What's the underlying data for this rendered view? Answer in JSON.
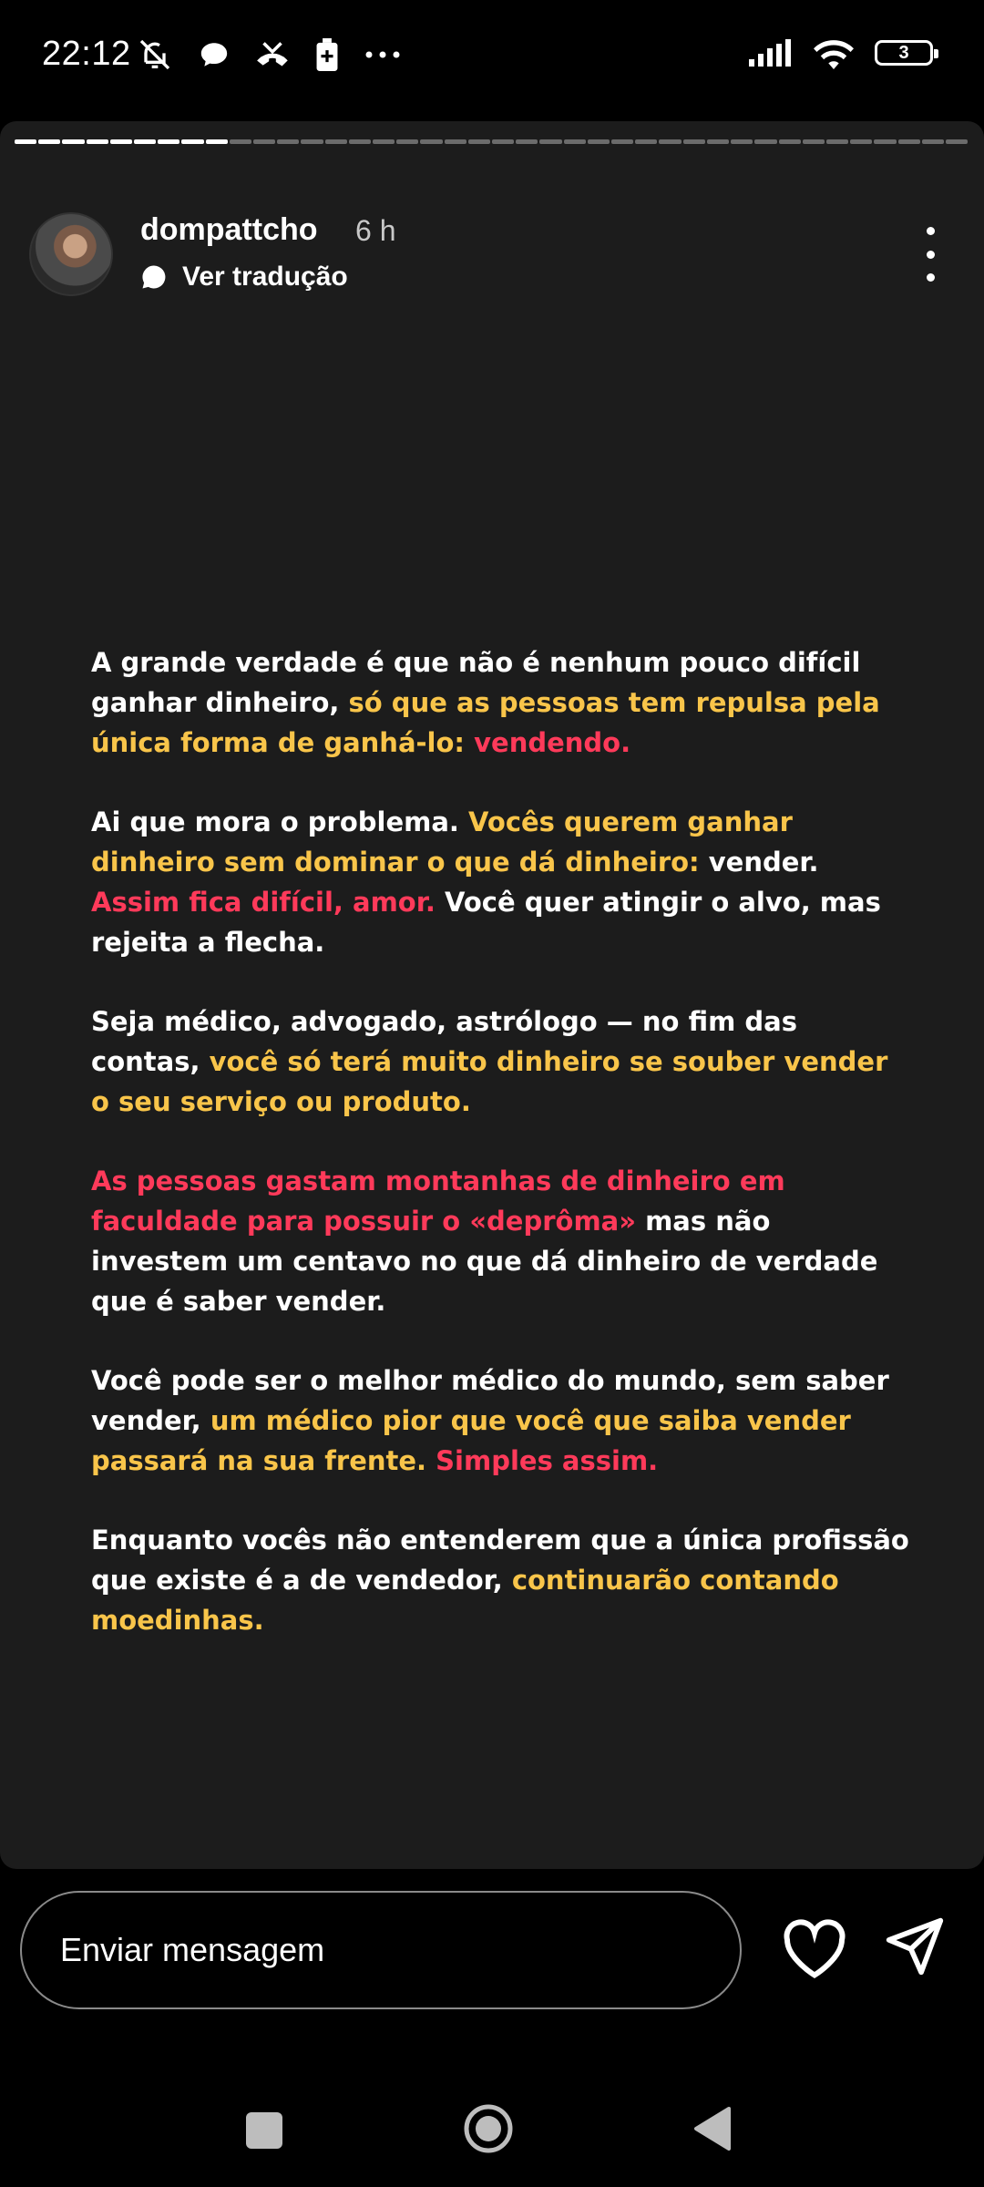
{
  "status_bar": {
    "time": "22:12",
    "battery_level": "3"
  },
  "story": {
    "username": "dompattcho",
    "time_ago": "6 h",
    "translate_label": "Ver tradução",
    "progress": {
      "segments_total": 40,
      "segments_viewed": 9
    },
    "paragraphs": [
      [
        {
          "text": "A grande verdade é que não é nenhum pouco difícil ganhar dinheiro, ",
          "color": "white"
        },
        {
          "text": "só que as pessoas tem repulsa pela única forma de ganhá-lo: ",
          "color": "yellow"
        },
        {
          "text": "vendendo.",
          "color": "red"
        }
      ],
      [
        {
          "text": "Ai que mora o problema. ",
          "color": "white"
        },
        {
          "text": "Vocês querem ganhar dinheiro sem dominar o que dá dinheiro: ",
          "color": "yellow"
        },
        {
          "text": "vender. ",
          "color": "white"
        },
        {
          "text": "Assim fica difícil, amor. ",
          "color": "red"
        },
        {
          "text": "Você quer atingir o alvo, mas rejeita a flecha.",
          "color": "white"
        }
      ],
      [
        {
          "text": "Seja médico, advogado, astrólogo — no fim das contas, ",
          "color": "white"
        },
        {
          "text": "você só terá muito dinheiro se souber vender o seu serviço ou produto.",
          "color": "yellow"
        }
      ],
      [
        {
          "text": "As pessoas gastam montanhas de dinheiro em faculdade para possuir o «deprôma» ",
          "color": "red"
        },
        {
          "text": "mas não investem um centavo no que dá dinheiro de verdade que é saber vender.",
          "color": "white"
        }
      ],
      [
        {
          "text": "Você pode ser o melhor médico do mundo, sem saber vender, ",
          "color": "white"
        },
        {
          "text": "um médico pior que você que saiba vender passará na sua frente. ",
          "color": "yellow"
        },
        {
          "text": "Simples assim.",
          "color": "red"
        }
      ],
      [
        {
          "text": "Enquanto vocês não entenderem que a única profissão que existe é a de vendedor, ",
          "color": "white"
        },
        {
          "text": "continuarão contando moedinhas.",
          "color": "yellow"
        }
      ]
    ]
  },
  "reply_bar": {
    "placeholder": "Enviar mensagem"
  },
  "colors": {
    "white": "#ffffff",
    "yellow": "#f9c54a",
    "red": "#ff3a5a",
    "card_bg": "#1c1c1c"
  },
  "icons": {
    "status_left": [
      "bell-off-icon",
      "chat-bubble-icon",
      "missed-call-icon",
      "battery-saver-icon",
      "more-dots-icon"
    ],
    "status_right": [
      "signal-icon",
      "wifi-icon",
      "battery-icon"
    ],
    "header": [
      "avatar",
      "translate-icon",
      "more-vertical-icon"
    ],
    "reply": [
      "heart-icon",
      "send-icon"
    ],
    "nav": [
      "recents-icon",
      "home-icon",
      "back-icon"
    ]
  }
}
